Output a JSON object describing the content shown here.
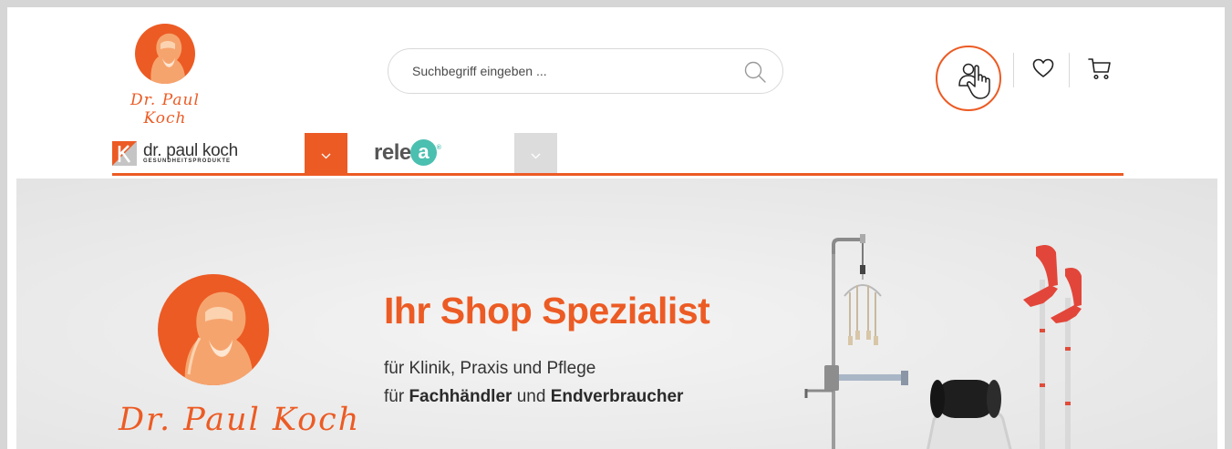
{
  "header": {
    "logo_signature": "Dr. Paul Koch",
    "search": {
      "placeholder": "Suchbegriff eingeben ..."
    }
  },
  "brands": {
    "dpk_name": "dr. paul koch",
    "dpk_sub": "GESUNDHEITSPRODUKTE",
    "relexa_prefix": "rele",
    "relexa_letter": "a",
    "relexa_mark": "®"
  },
  "hero": {
    "signature": "Dr. Paul Koch",
    "title": "Ihr Shop Spezialist",
    "line1": "für Klinik, Praxis und Pflege",
    "line2_pre": "für ",
    "line2_bold1": "Fachhändler",
    "line2_mid": " und ",
    "line2_bold2": "Endverbraucher"
  },
  "colors": {
    "accent": "#ec5b24",
    "relexa": "#4bbfb0",
    "hero_bg": "#ececec"
  },
  "icons": [
    "search-icon",
    "user-icon",
    "pointer-hand-icon",
    "heart-icon",
    "cart-icon",
    "chevron-down-icon"
  ]
}
